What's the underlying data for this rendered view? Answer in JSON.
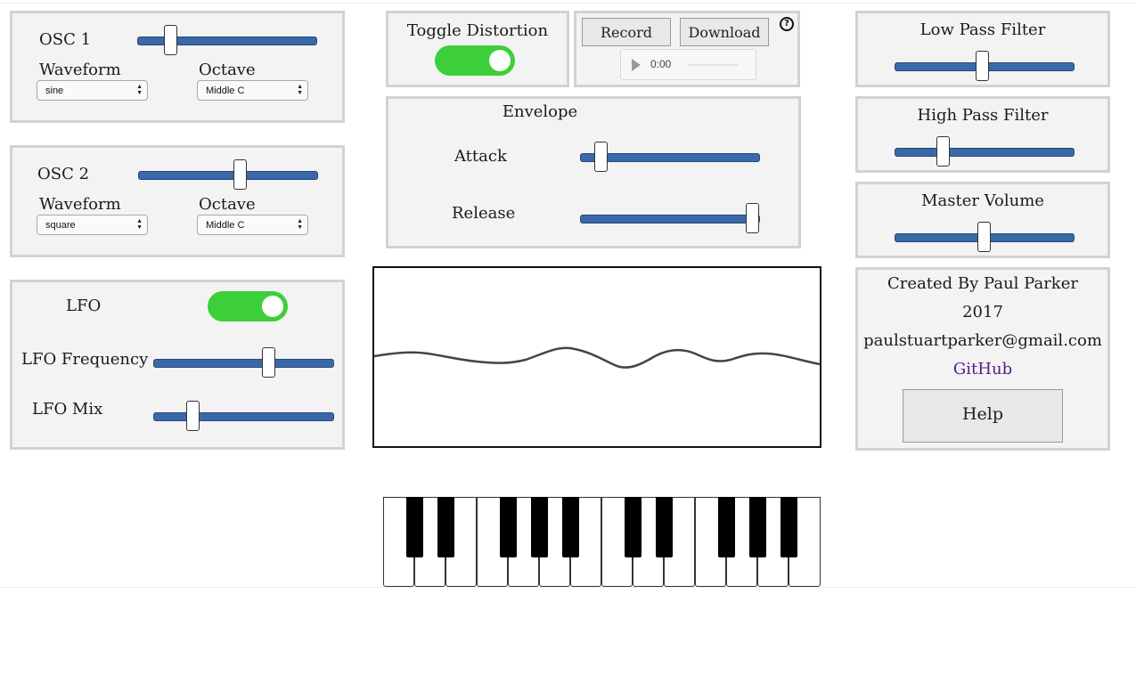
{
  "osc1": {
    "title": "OSC 1",
    "slider_value": 0.19,
    "waveform_label": "Waveform",
    "octave_label": "Octave",
    "waveform_value": "sine",
    "octave_value": "Middle C"
  },
  "osc2": {
    "title": "OSC 2",
    "slider_value": 0.57,
    "waveform_label": "Waveform",
    "octave_label": "Octave",
    "waveform_value": "square",
    "octave_value": "Middle C"
  },
  "lfo": {
    "title": "LFO",
    "enabled": true,
    "frequency_label": "LFO Frequency",
    "frequency_value": 0.64,
    "mix_label": "LFO Mix",
    "mix_value": 0.22
  },
  "distortion": {
    "label": "Toggle Distortion",
    "enabled": true
  },
  "recorder": {
    "record_label": "Record",
    "download_label": "Download",
    "help_symbol": "?",
    "time": "0:00"
  },
  "envelope": {
    "title": "Envelope",
    "attack_label": "Attack",
    "attack_value": 0.12,
    "release_label": "Release",
    "release_value": 0.96
  },
  "filters": {
    "low_pass_label": "Low Pass Filter",
    "low_pass_value": 0.49,
    "high_pass_label": "High Pass Filter",
    "high_pass_value": 0.27,
    "master_label": "Master Volume",
    "master_value": 0.5
  },
  "credits": {
    "line1": "Created By Paul Parker",
    "line2": "2017",
    "email": "paulstuartparker@gmail.com",
    "github": "GitHub",
    "help_label": "Help"
  },
  "colors": {
    "slider_track": "#3a68a8",
    "toggle_on": "#3ccf3a",
    "link": "#5a1a8a",
    "panel_bg": "#f3f3f3",
    "panel_border": "#d2d2d2"
  },
  "icons": {
    "play": "play-icon",
    "help": "question-circle-icon"
  }
}
